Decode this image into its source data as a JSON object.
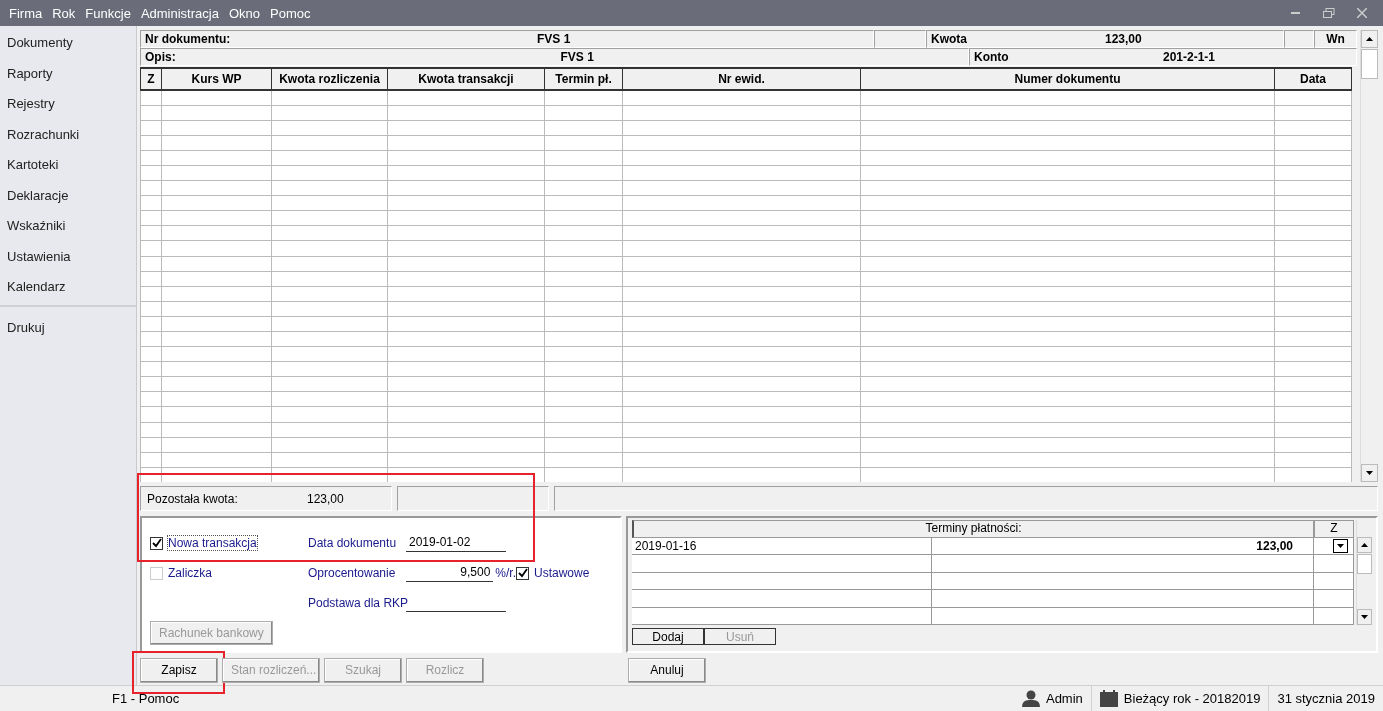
{
  "menu": [
    "Firma",
    "Rok",
    "Funkcje",
    "Administracja",
    "Okno",
    "Pomoc"
  ],
  "sidebar": {
    "groups": [
      [
        "Dokumenty",
        "Raporty",
        "Rejestry",
        "Rozrachunki",
        "Kartoteki",
        "Deklaracje",
        "Wskaźniki",
        "Ustawienia",
        "Kalendarz"
      ],
      [
        "Drukuj"
      ]
    ]
  },
  "document": {
    "nr_label": "Nr dokumentu:",
    "nr_value": "FVS 1",
    "kwota_label": "Kwota",
    "kwota_value": "123,00",
    "side": "Wn",
    "opis_label": "Opis:",
    "opis_value": "FVS 1",
    "konto_label": "Konto",
    "konto_value": "201-2-1-1"
  },
  "table": {
    "columns": [
      "Z",
      "Kurs WP",
      "Kwota rozliczenia",
      "Kwota transakcji",
      "Termin pł.",
      "Nr ewid.",
      "Numer dokumentu",
      "Data"
    ]
  },
  "remaining": {
    "label": "Pozostała kwota:",
    "value": "123,00",
    "outlined": true
  },
  "form": {
    "new_transaction": {
      "label": "Nowa transakcja",
      "checked": true,
      "focused": true
    },
    "advance": {
      "label": "Zaliczka",
      "checked": false
    },
    "document_date": {
      "label": "Data dokumentu",
      "value": "2019-01-02"
    },
    "interest": {
      "label": "Oprocentowanie",
      "value": "9,500",
      "unit": "%/r."
    },
    "statutory": {
      "label": "Ustawowe",
      "checked": true
    },
    "rkp_base": {
      "label": "Podstawa dla RKP"
    },
    "bank_account_button": {
      "label": "Rachunek bankowy",
      "disabled": true
    }
  },
  "payment_terms": {
    "title": "Terminy płatności:",
    "z_header": "Z",
    "rows": [
      {
        "date": "2019-01-16",
        "amount": "123,00"
      }
    ],
    "buttons": [
      {
        "label": "Dodaj",
        "disabled": false
      },
      {
        "label": "Usuń",
        "disabled": true
      }
    ]
  },
  "actions": [
    {
      "label": "Zapisz",
      "disabled": false,
      "outlined": true
    },
    {
      "label": "Stan rozliczeń...",
      "disabled": true,
      "outlined": false
    },
    {
      "label": "Szukaj",
      "disabled": true,
      "outlined": false
    },
    {
      "label": "Rozlicz",
      "disabled": true,
      "outlined": false
    }
  ],
  "cancel": {
    "label": "Anuluj",
    "disabled": false
  },
  "status_bar": {
    "help": "F1 - Pomoc",
    "user": "Admin",
    "year": "Bieżący rok - 20182019",
    "date": "31 stycznia 2019"
  }
}
